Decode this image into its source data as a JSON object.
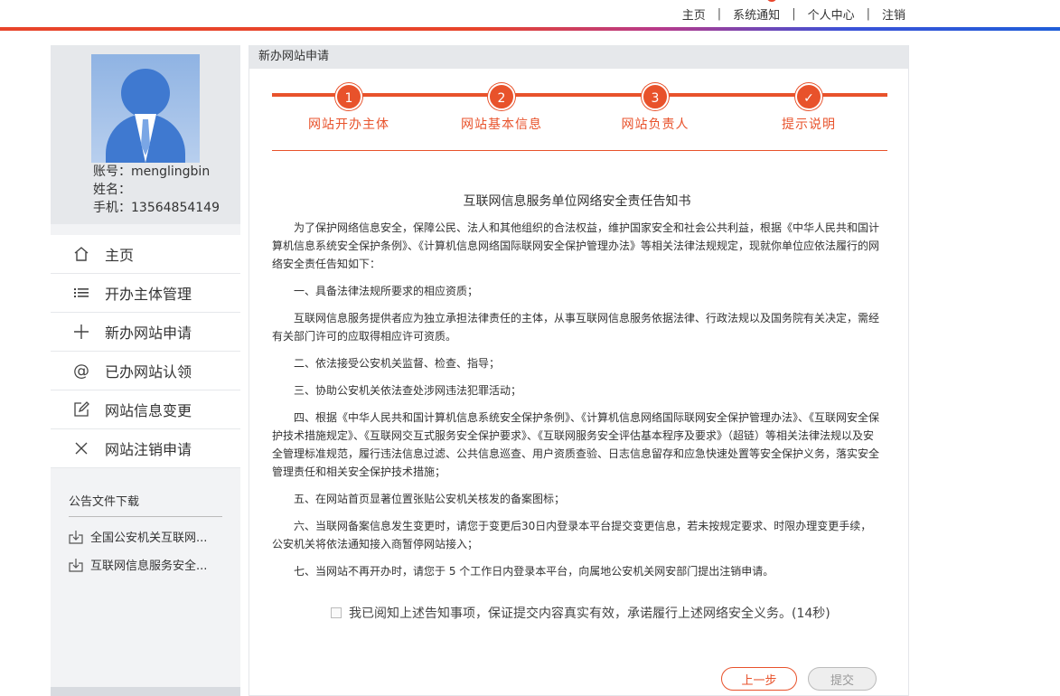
{
  "topnav": {
    "home": "主页",
    "notifications": "系统通知",
    "profile_center": "个人中心",
    "logout": "注销",
    "separator": "|"
  },
  "profile": {
    "account": "账号：menglingbin",
    "name": "姓名：",
    "phone": "手机：13564854149"
  },
  "menu": [
    {
      "label": "主页",
      "icon": "home-icon"
    },
    {
      "label": "开办主体管理",
      "icon": "list-icon"
    },
    {
      "label": "新办网站申请",
      "icon": "plus-icon"
    },
    {
      "label": "已办网站认领",
      "icon": "at-icon"
    },
    {
      "label": "网站信息变更",
      "icon": "edit-icon"
    },
    {
      "label": "网站注销申请",
      "icon": "close-icon"
    }
  ],
  "docs": {
    "title": "公告文件下载",
    "items": [
      "全国公安机关互联网...",
      "互联网信息服务安全..."
    ]
  },
  "main": {
    "header": "新办网站申请",
    "steps": [
      {
        "number": "1",
        "label": "网站开办主体"
      },
      {
        "number": "2",
        "label": "网站基本信息"
      },
      {
        "number": "3",
        "label": "网站负责人"
      },
      {
        "number": "✓",
        "label": "提示说明"
      }
    ],
    "notice": {
      "title": "互联网信息服务单位网络安全责任告知书",
      "paragraphs": [
        "为了保护网络信息安全，保障公民、法人和其他组织的合法权益，维护国家安全和社会公共利益，根据《中华人民共和国计算机信息系统安全保护条例》、《计算机信息网络国际联网安全保护管理办法》等相关法律法规规定，现就你单位应依法履行的网络安全责任告知如下：",
        "一、具备法律法规所要求的相应资质；",
        "互联网信息服务提供者应为独立承担法律责任的主体，从事互联网信息服务依据法律、行政法规以及国务院有关决定，需经有关部门许可的应取得相应许可资质。",
        "二、依法接受公安机关监督、检查、指导；",
        "三、协助公安机关依法查处涉网违法犯罪活动；",
        "四、根据《中华人民共和国计算机信息系统安全保护条例》、《计算机信息网络国际联网安全保护管理办法》、《互联网安全保护技术措施规定》、《互联网交互式服务安全保护要求》、《互联网服务安全评估基本程序及要求》（超链）等相关法律法规以及安全管理标准规范，履行违法信息过滤、公共信息巡查、用户资质查验、日志信息留存和应急快速处置等安全保护义务，落实安全管理责任和相关安全保护技术措施；",
        "五、在网站首页显著位置张贴公安机关核发的备案图标；",
        "六、当联网备案信息发生变更时，请您于变更后30日内登录本平台提交变更信息，若未按规定要求、时限办理变更手续，公安机关将依法通知接入商暂停网站接入；",
        "七、当网站不再开办时，请您于 5 个工作日内登录本平台，向属地公安机关网安部门提出注销申请。"
      ]
    },
    "agree_text": "我已阅知上述告知事项，保证提交内容真实有效，承诺履行上述网络安全义务。(14秒)",
    "buttons": {
      "prev": "上一步",
      "submit": "提交"
    }
  },
  "colors": {
    "accent": "#e8522b",
    "sidebar_bg": "#f2f3f5"
  }
}
